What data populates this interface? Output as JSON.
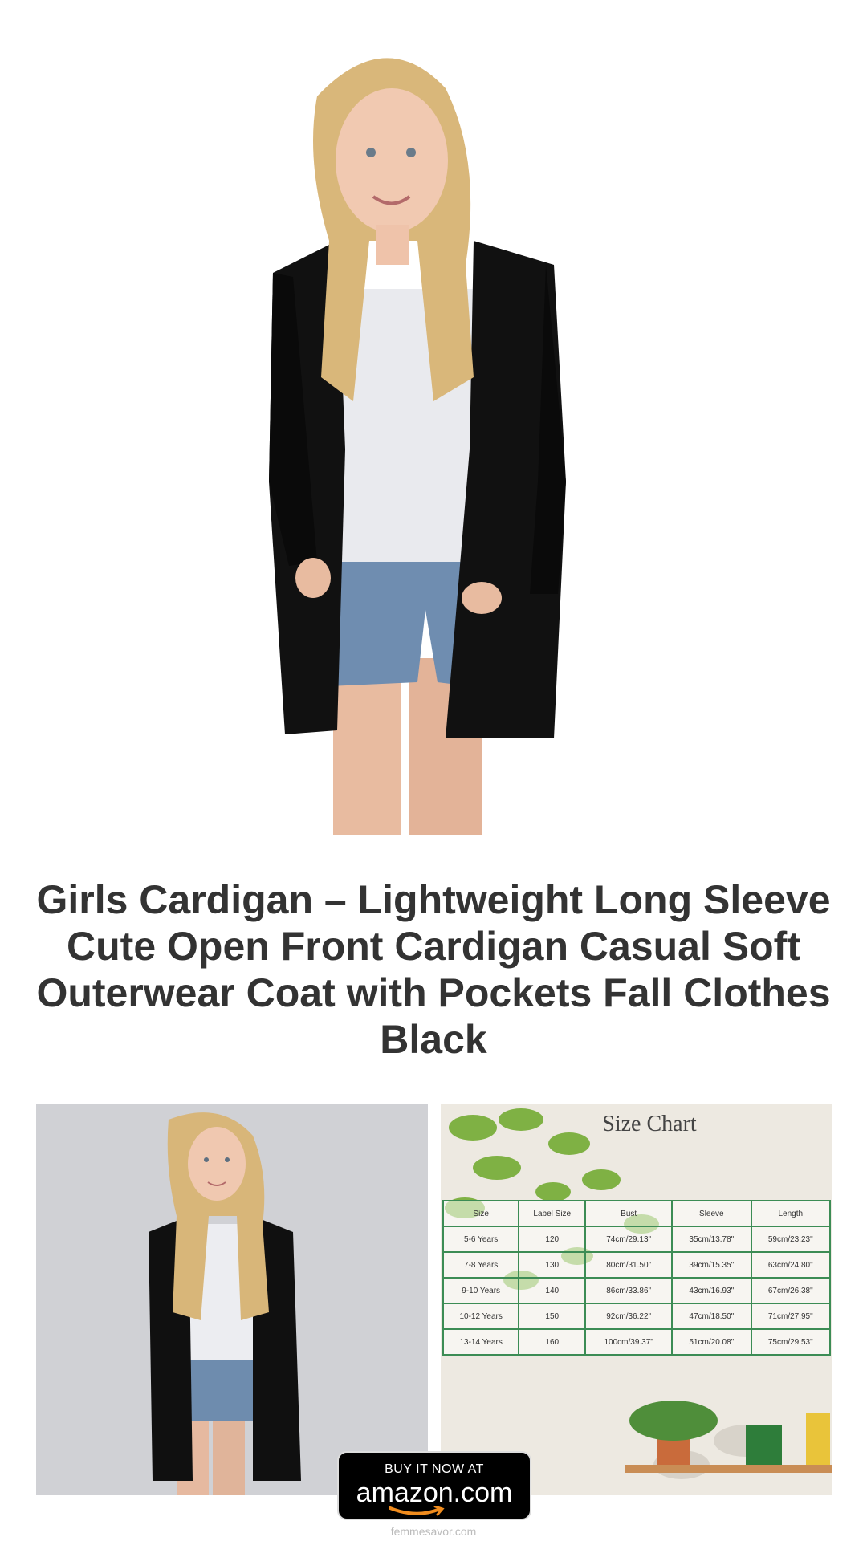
{
  "product": {
    "title": "Girls Cardigan – Lightweight Long Sleeve Cute Open Front Cardigan Casual Soft Outerwear Coat with Pockets Fall Clothes Black",
    "hero_image": "girl-in-black-cardigan-photo",
    "thumbnail_left_image": "girl-in-black-cardigan-gray-background-photo",
    "thumbnail_right_image": "size-chart-leaves-background"
  },
  "size_chart": {
    "title": "Size Chart",
    "headers": [
      "Size",
      "Label Size",
      "Bust",
      "Sleeve",
      "Length"
    ],
    "rows": [
      [
        "5-6 Years",
        "120",
        "74cm/29.13\"",
        "35cm/13.78\"",
        "59cm/23.23\""
      ],
      [
        "7-8 Years",
        "130",
        "80cm/31.50\"",
        "39cm/15.35\"",
        "63cm/24.80\""
      ],
      [
        "9-10 Years",
        "140",
        "86cm/33.86\"",
        "43cm/16.93\"",
        "67cm/26.38\""
      ],
      [
        "10-12 Years",
        "150",
        "92cm/36.22\"",
        "47cm/18.50\"",
        "71cm/27.95\""
      ],
      [
        "13-14 Years",
        "160",
        "100cm/39.37\"",
        "51cm/20.08\"",
        "75cm/29.53\""
      ]
    ]
  },
  "buy_button": {
    "top_label": "BUY IT NOW AT",
    "brand": "amazon.com"
  },
  "footer": {
    "site": "femmesavor.com"
  },
  "colors": {
    "title_text": "#333333",
    "table_border": "#3c8c55",
    "button_bg": "#000000",
    "smile_accent": "#f08c1e"
  }
}
